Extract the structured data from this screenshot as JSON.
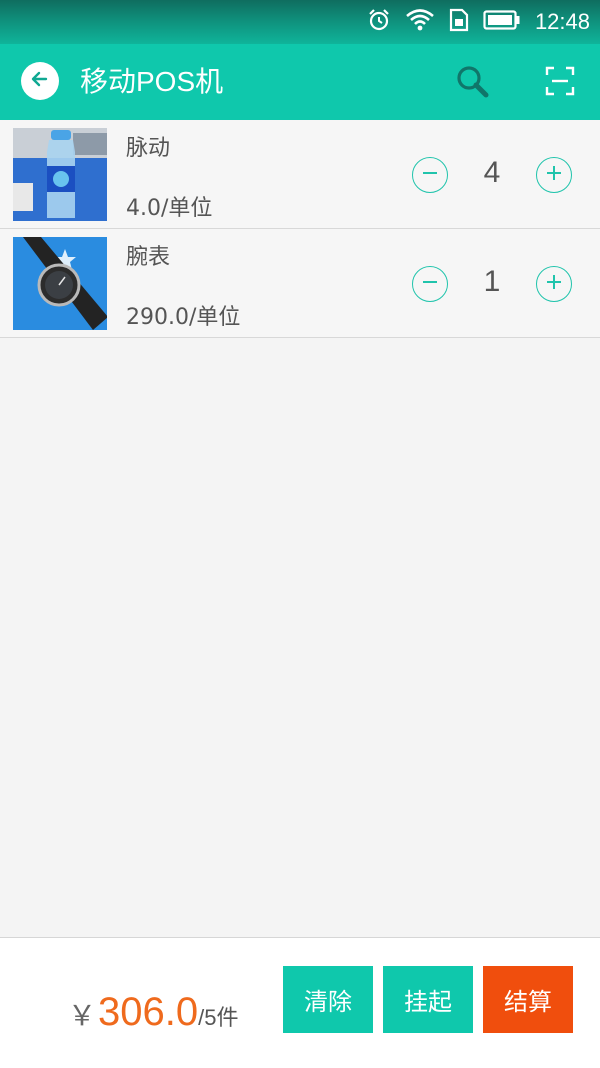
{
  "status_bar": {
    "time": "12:48",
    "icons": [
      "alarm-icon",
      "wifi-icon",
      "sim-icon",
      "battery-icon"
    ]
  },
  "app_bar": {
    "title": "移动POS机",
    "icons": [
      "back-arrow-icon",
      "search-icon",
      "scan-icon"
    ]
  },
  "items": [
    {
      "name": "脉动",
      "price": "4.0/单位",
      "qty": "4",
      "image": "bottled-drink-photo"
    },
    {
      "name": "腕表",
      "price": "290.0/单位",
      "qty": "1",
      "image": "wristwatch-photo"
    }
  ],
  "footer": {
    "currency": "￥",
    "total": "306.0",
    "count": "/5件",
    "buttons": {
      "clear": "清除",
      "hold": "挂起",
      "checkout": "结算"
    }
  },
  "colors": {
    "accent": "#0fc8ac",
    "checkout": "#f04e0d",
    "price": "#ef6a1d"
  }
}
